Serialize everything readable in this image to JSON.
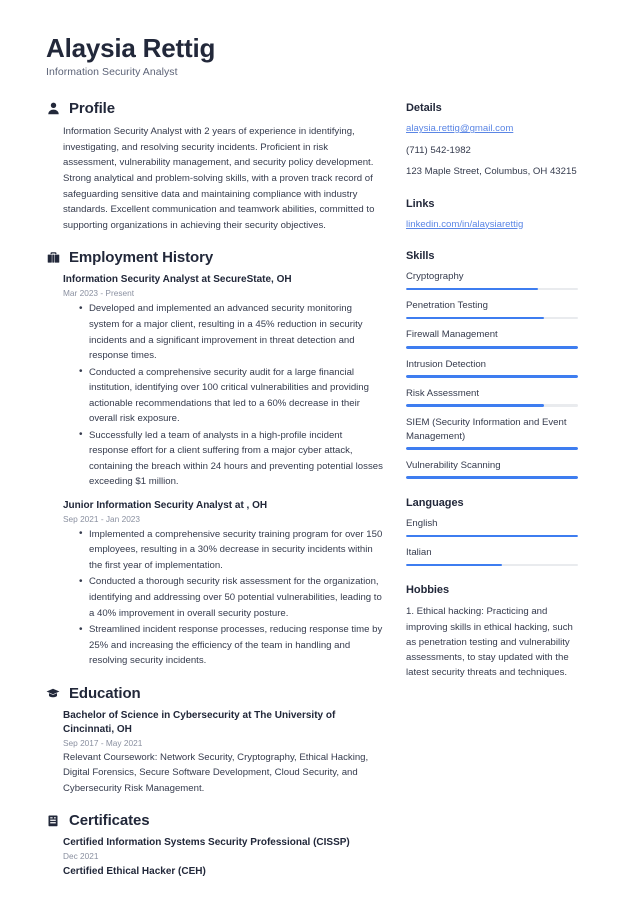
{
  "header": {
    "full_name": "Alaysia Rettig",
    "job_title": "Information Security Analyst"
  },
  "colors": {
    "accent": "#3e7df0",
    "link": "#5b86e5",
    "heading": "#22283a",
    "body_text": "#353b4d",
    "muted": "#8a90a0",
    "track": "#e9ebee"
  },
  "main": {
    "profile": {
      "icon": "user-icon",
      "title": "Profile",
      "text": "Information Security Analyst with 2 years of experience in identifying, investigating, and resolving security incidents. Proficient in risk assessment, vulnerability management, and security policy development. Strong analytical and problem-solving skills, with a proven track record of safeguarding sensitive data and maintaining compliance with industry standards. Excellent communication and teamwork abilities, committed to supporting organizations in achieving their security objectives."
    },
    "employment": {
      "icon": "briefcase-icon",
      "title": "Employment History",
      "entries": [
        {
          "title": "Information Security Analyst at SecureState, OH",
          "date": "Mar 2023 - Present",
          "bullets": [
            "Developed and implemented an advanced security monitoring system for a major client, resulting in a 45% reduction in security incidents and a significant improvement in threat detection and response times.",
            "Conducted a comprehensive security audit for a large financial institution, identifying over 100 critical vulnerabilities and providing actionable recommendations that led to a 60% decrease in their overall risk exposure.",
            "Successfully led a team of analysts in a high-profile incident response effort for a client suffering from a major cyber attack, containing the breach within 24 hours and preventing potential losses exceeding $1 million."
          ]
        },
        {
          "title": "Junior Information Security Analyst at , OH",
          "date": "Sep 2021 - Jan 2023",
          "bullets": [
            "Implemented a comprehensive security training program for over 150 employees, resulting in a 30% decrease in security incidents within the first year of implementation.",
            "Conducted a thorough security risk assessment for the organization, identifying and addressing over 50 potential vulnerabilities, leading to a 40% improvement in overall security posture.",
            "Streamlined incident response processes, reducing response time by 25% and increasing the efficiency of the team in handling and resolving security incidents."
          ]
        }
      ]
    },
    "education": {
      "icon": "graduation-cap-icon",
      "title": "Education",
      "entries": [
        {
          "title": "Bachelor of Science in Cybersecurity at The University of Cincinnati, OH",
          "date": "Sep 2017 - May 2021",
          "description": "Relevant Coursework: Network Security, Cryptography, Ethical Hacking, Digital Forensics, Secure Software Development, Cloud Security, and Cybersecurity Risk Management."
        }
      ]
    },
    "certificates": {
      "icon": "clipboard-icon",
      "title": "Certificates",
      "entries": [
        {
          "title": "Certified Information Systems Security Professional (CISSP)",
          "date": "Dec 2021"
        },
        {
          "title": "Certified Ethical Hacker (CEH)",
          "date": ""
        }
      ]
    }
  },
  "sidebar": {
    "details": {
      "title": "Details",
      "email": "alaysia.rettig@gmail.com",
      "phone": "(711) 542-1982",
      "address": "123 Maple Street, Columbus, OH 43215"
    },
    "links": {
      "title": "Links",
      "items": [
        {
          "label": "linkedin.com/in/alaysiarettig"
        }
      ]
    },
    "skills": {
      "title": "Skills",
      "items": [
        {
          "label": "Cryptography",
          "level": 77
        },
        {
          "label": "Penetration Testing",
          "level": 80
        },
        {
          "label": "Firewall Management",
          "level": 100
        },
        {
          "label": "Intrusion Detection",
          "level": 100
        },
        {
          "label": "Risk Assessment",
          "level": 80
        },
        {
          "label": "SIEM (Security Information and Event Management)",
          "level": 100
        },
        {
          "label": "Vulnerability Scanning",
          "level": 100
        }
      ]
    },
    "languages": {
      "title": "Languages",
      "items": [
        {
          "label": "English",
          "level": 100
        },
        {
          "label": "Italian",
          "level": 56
        }
      ]
    },
    "hobbies": {
      "title": "Hobbies",
      "text": "1. Ethical hacking: Practicing and improving skills in ethical hacking, such as penetration testing and vulnerability assessments, to stay updated with the latest security threats and techniques."
    }
  }
}
